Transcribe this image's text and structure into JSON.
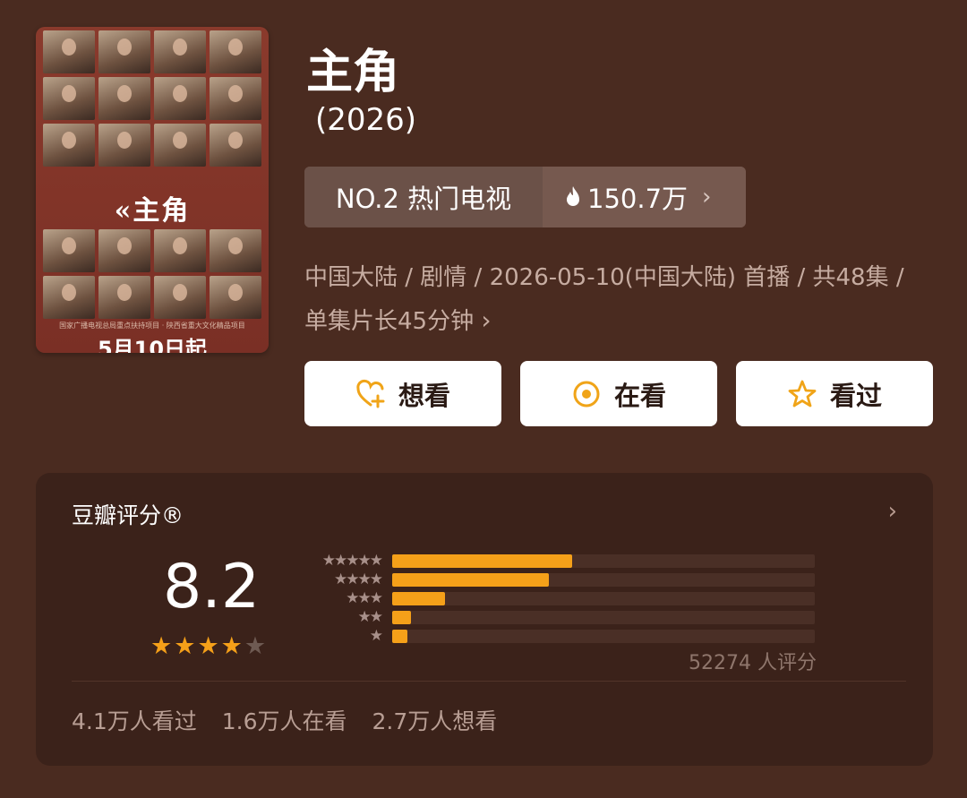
{
  "poster": {
    "title": "«主角",
    "date": "5月10日起",
    "small_print": "国家广播电视总局重点扶持项目 · 陕西省重大文化精品项目"
  },
  "title": "主角",
  "year": "(2026)",
  "rank": {
    "label": "NO.2 热门电视",
    "heat": "150.7万",
    "icon": "flame-icon"
  },
  "meta": "中国大陆 / 剧情 / 2026-05-10(中国大陆) 首播 / 共48集 / 单集片长45分钟",
  "buttons": [
    {
      "label": "想看",
      "icon": "heart-plus-icon"
    },
    {
      "label": "在看",
      "icon": "target-icon"
    },
    {
      "label": "看过",
      "icon": "star-outline-icon"
    }
  ],
  "rating": {
    "title": "豆瓣评分®",
    "score": "8.2",
    "stars_filled": 4,
    "stars_total": 5,
    "distribution": [
      {
        "stars": 5,
        "percent": 42.5
      },
      {
        "stars": 4,
        "percent": 37
      },
      {
        "stars": 3,
        "percent": 12.5
      },
      {
        "stars": 2,
        "percent": 4.5
      },
      {
        "stars": 1,
        "percent": 3.5
      }
    ],
    "raters": "52274 人评分"
  },
  "stats": [
    "4.1万人看过",
    "1.6万人在看",
    "2.7万人想看"
  ],
  "colors": {
    "background": "#4a2b20",
    "card": "#3b221a",
    "accent": "#f5a019",
    "button_icon": "#f0a418"
  }
}
